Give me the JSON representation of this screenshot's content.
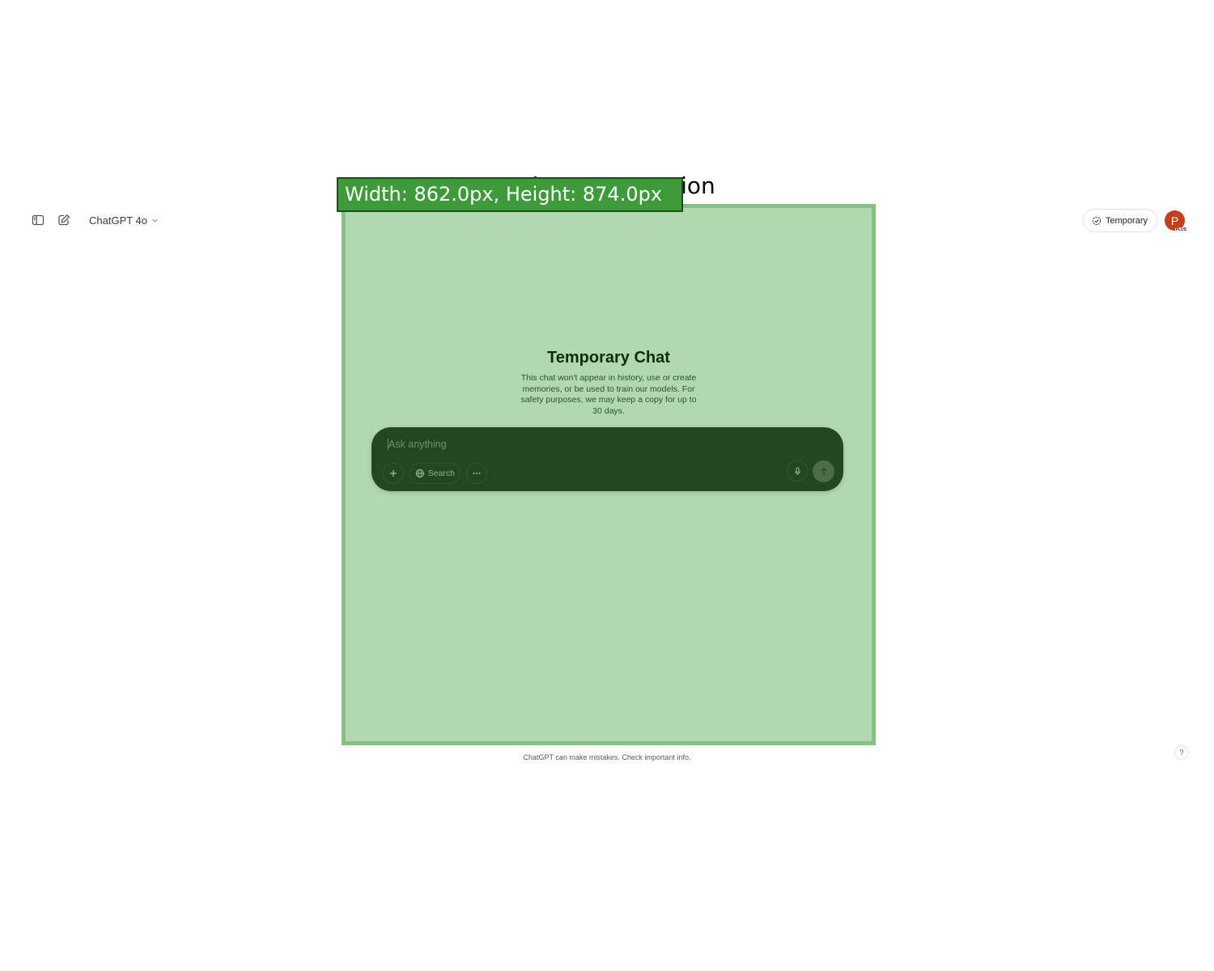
{
  "header": {
    "model_label": "ChatGPT 4o",
    "temporary_label": "Temporary",
    "avatar_initial": "P",
    "avatar_badge": "PLUS",
    "icons": [
      "sidebar-toggle-icon",
      "new-chat-icon",
      "chevron-down-icon",
      "temporary-chat-icon"
    ]
  },
  "overlay": {
    "title": "Main Area Location",
    "label": "Width: 862.0px, Height: 874.0px"
  },
  "hero": {
    "title": "Temporary Chat",
    "description": "This chat won't appear in history, use or create memories, or be used to train our models. For safety purposes, we may keep a copy for up to 30 days."
  },
  "composer": {
    "placeholder": "Ask anything",
    "search_label": "Search",
    "icons": [
      "plus-icon",
      "globe-icon",
      "more-icon",
      "microphone-icon",
      "arrow-up-icon"
    ]
  },
  "footer": {
    "disclaimer": "ChatGPT can make mistakes. Check important info.",
    "help_label": "?"
  },
  "colors": {
    "overlay_fill": "#b2d8b0",
    "overlay_border": "#86c083",
    "label_bg": "#3e9b3a",
    "composer_bg": "#234821",
    "avatar_bg": "#c63d17"
  }
}
